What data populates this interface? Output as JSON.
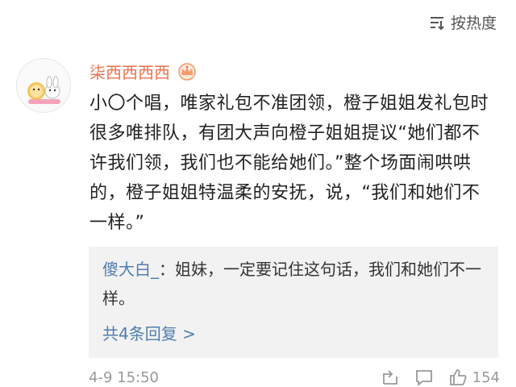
{
  "header": {
    "sort_label": "按热度",
    "sort_icon": "sort-lines-icon"
  },
  "comment": {
    "username": "柒西西西西",
    "badge_icon": "vip-crown-icon",
    "text": "小〇个唱，唯家礼包不准团领，橙子姐姐发礼包时很多唯排队，有团大声向橙子姐姐提议“她们都不许我们领，我们也不能给她们。”整个场面闹哄哄的，橙子姐姐特温柔的安抚，说，“我们和她们不一样。”",
    "timestamp": "4-9 15:50",
    "like_count": "154"
  },
  "reply": {
    "username": "傻大白_",
    "text": "：姐妹，一定要记住这句话，我们和她们不一样。",
    "more_label": "共4条回复 >"
  },
  "colors": {
    "username": "#eb7350",
    "link": "#507daf",
    "reply_bg": "#f2f2f2"
  }
}
